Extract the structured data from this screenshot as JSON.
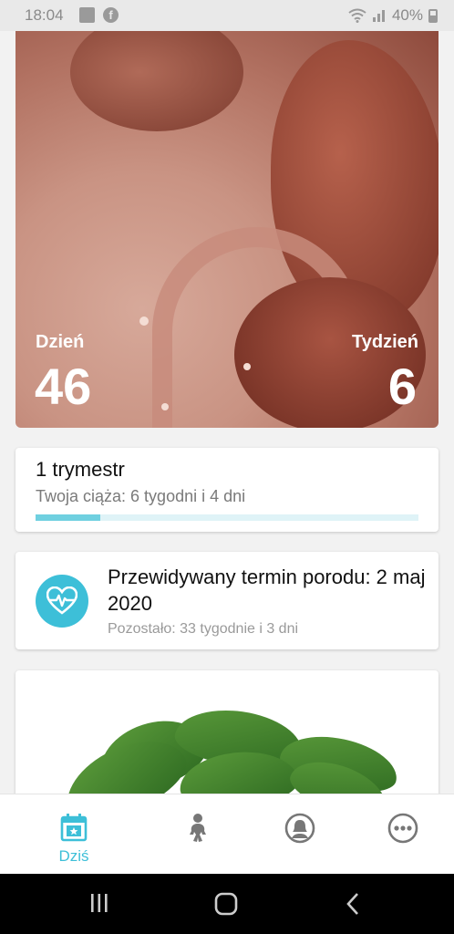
{
  "status_bar": {
    "time": "18:04",
    "battery": "40%"
  },
  "hero": {
    "day_label": "Dzień",
    "day_value": "46",
    "week_label": "Tydzień",
    "week_value": "6"
  },
  "trimester_card": {
    "title": "1 trymestr",
    "subtitle": "Twoja ciąża: 6 tygodni i 4 dni",
    "progress_fraction": 0.17
  },
  "due_date_card": {
    "icon": "heartbeat-icon",
    "title": "Przewidywany termin porodu: 2 maj 2020",
    "subtitle": "Pozostało: 33 tygodnie i 3 dni"
  },
  "bottom_nav": {
    "items": [
      {
        "label": "Dziś",
        "icon": "calendar-star-icon",
        "active": true
      },
      {
        "label": "",
        "icon": "baby-icon",
        "active": false
      },
      {
        "label": "",
        "icon": "mother-profile-icon",
        "active": false
      },
      {
        "label": "",
        "icon": "more-icon",
        "active": false
      }
    ]
  },
  "colors": {
    "accent": "#3dbfd8",
    "progress_track": "#dff3f7",
    "progress_fill": "#6fd0e0"
  }
}
